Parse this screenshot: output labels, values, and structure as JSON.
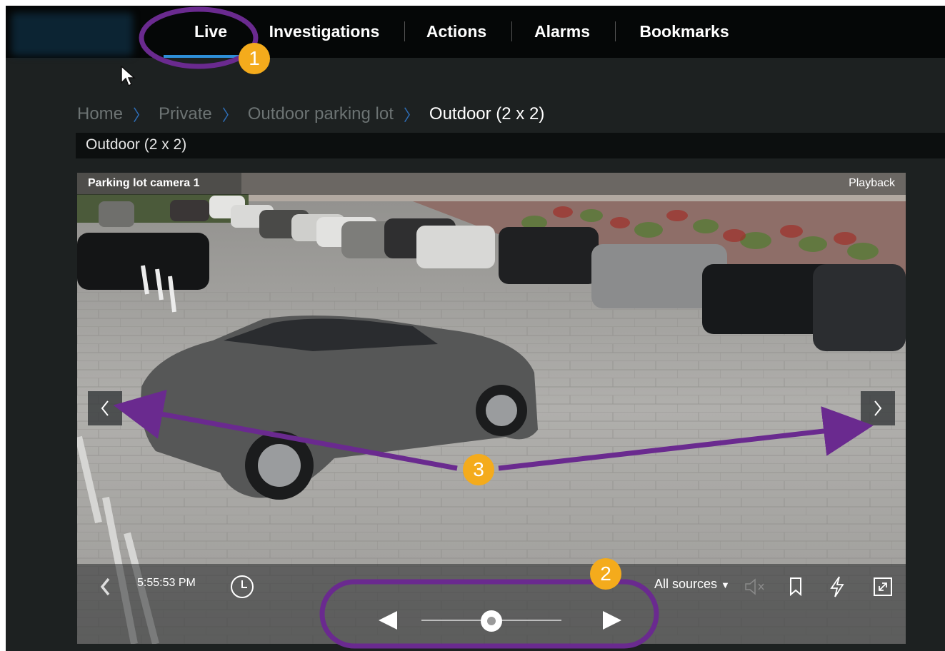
{
  "nav": {
    "items": [
      {
        "label": "Live",
        "active": true
      },
      {
        "label": "Investigations",
        "active": false
      },
      {
        "label": "Actions",
        "active": false
      },
      {
        "label": "Alarms",
        "active": false
      },
      {
        "label": "Bookmarks",
        "active": false
      }
    ]
  },
  "breadcrumb": {
    "items": [
      "Home",
      "Private",
      "Outdoor parking lot"
    ],
    "current": "Outdoor (2 x 2)"
  },
  "view": {
    "title": "Outdoor (2 x 2)"
  },
  "camera": {
    "name": "Parking lot camera 1",
    "mode": "Playback",
    "time": "5:55:53 PM",
    "sources": "All sources",
    "speed_position": 0.5
  },
  "annotations": {
    "badge_1": "1",
    "badge_2": "2",
    "badge_3": "3"
  },
  "colors": {
    "accent": "#2e8fd8",
    "annotation": "#f4ab1c",
    "annotation_outline": "#6a2a8f",
    "topbar": "#050707",
    "background": "#1d2121"
  },
  "icons": {
    "prev": "chevron-left-icon",
    "next": "chevron-right-icon",
    "clock": "clock-icon",
    "mute": "speaker-muted-icon",
    "bookmark": "bookmark-icon",
    "action": "lightning-icon",
    "fullscreen": "expand-icon"
  }
}
